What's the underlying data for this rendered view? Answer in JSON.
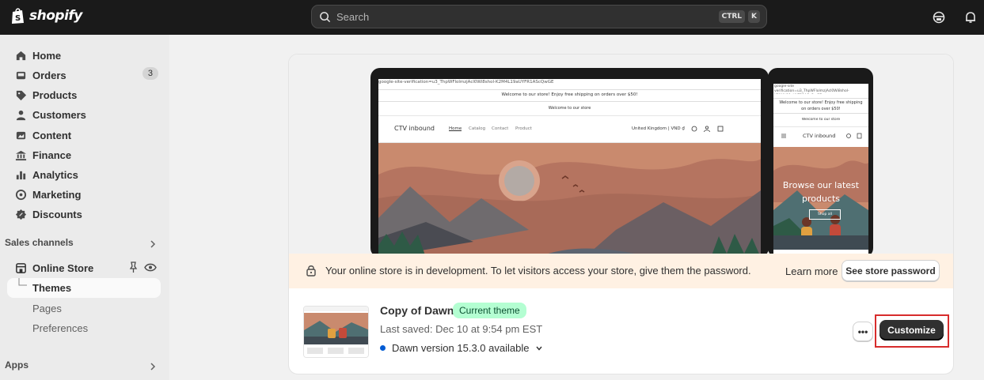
{
  "topbar": {
    "brand": "shopify",
    "search_placeholder": "Search",
    "shortcut_keys": [
      "CTRL",
      "K"
    ],
    "icons": [
      "store-icon",
      "bell-icon"
    ]
  },
  "sidebar": {
    "items": [
      {
        "label": "Home",
        "icon": "home-icon"
      },
      {
        "label": "Orders",
        "icon": "inbox-icon",
        "badge": "3"
      },
      {
        "label": "Products",
        "icon": "tag-icon"
      },
      {
        "label": "Customers",
        "icon": "person-icon"
      },
      {
        "label": "Content",
        "icon": "image-icon"
      },
      {
        "label": "Finance",
        "icon": "bank-icon"
      },
      {
        "label": "Analytics",
        "icon": "bar-chart-icon"
      },
      {
        "label": "Marketing",
        "icon": "target-icon"
      },
      {
        "label": "Discounts",
        "icon": "discount-icon"
      }
    ],
    "sales_channels_label": "Sales channels",
    "online_store": {
      "label": "Online Store",
      "sub_items": [
        "Themes",
        "Pages",
        "Preferences"
      ],
      "selected": "Themes"
    },
    "apps_label": "Apps"
  },
  "preview": {
    "desktop": {
      "meta_line": "google-site-verification=u3_ThpWFlolmzjAcl0Wi8shol-K2M4L19aUYFR1AScQwGE",
      "announcement": "Welcome to our store! Enjoy free shipping on orders over $50!",
      "sub_announcement": "Welcome to our store",
      "store_name": "CTV inbound",
      "nav": [
        "Home",
        "Catalog",
        "Contact",
        "Product"
      ],
      "locale": "United Kingdom | VND ₫"
    },
    "mobile": {
      "meta_line": "google-site verification=u3_ThpWFlolmzjAcl0Wi8shol-K2M4L19aUYFR1AScQwGE",
      "announcement": "Welcome to our store! Enjoy free shipping on orders over $50!",
      "sub_announcement": "Welcome to our store",
      "store_name": "CTV inbound",
      "hero_heading": "Browse our latest products",
      "hero_button": "Shop all"
    }
  },
  "dev_banner": {
    "text": "Your online store is in development. To let visitors access your store, give them the password.",
    "learn_more": "Learn more",
    "button": "See store password"
  },
  "theme": {
    "name": "Copy of Dawn",
    "status_badge": "Current theme",
    "last_saved": "Last saved: Dec 10 at 9:54 pm EST",
    "version": "Dawn version 15.3.0 available",
    "more_button": "•••",
    "customize_button": "Customize"
  },
  "colors": {
    "topbar": "#1a1a1a",
    "badge_green": "#b4fed2",
    "primary_button": "#303030",
    "highlight": "#d72c2c",
    "banner": "#fff1e3"
  }
}
